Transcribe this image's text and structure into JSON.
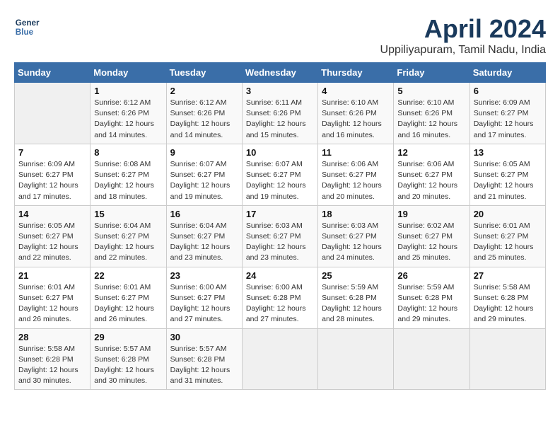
{
  "header": {
    "logo_line1": "General",
    "logo_line2": "Blue",
    "title": "April 2024",
    "subtitle": "Uppiliyapuram, Tamil Nadu, India"
  },
  "calendar": {
    "days_of_week": [
      "Sunday",
      "Monday",
      "Tuesday",
      "Wednesday",
      "Thursday",
      "Friday",
      "Saturday"
    ],
    "weeks": [
      [
        {
          "day": "",
          "info": ""
        },
        {
          "day": "1",
          "info": "Sunrise: 6:12 AM\nSunset: 6:26 PM\nDaylight: 12 hours\nand 14 minutes."
        },
        {
          "day": "2",
          "info": "Sunrise: 6:12 AM\nSunset: 6:26 PM\nDaylight: 12 hours\nand 14 minutes."
        },
        {
          "day": "3",
          "info": "Sunrise: 6:11 AM\nSunset: 6:26 PM\nDaylight: 12 hours\nand 15 minutes."
        },
        {
          "day": "4",
          "info": "Sunrise: 6:10 AM\nSunset: 6:26 PM\nDaylight: 12 hours\nand 16 minutes."
        },
        {
          "day": "5",
          "info": "Sunrise: 6:10 AM\nSunset: 6:26 PM\nDaylight: 12 hours\nand 16 minutes."
        },
        {
          "day": "6",
          "info": "Sunrise: 6:09 AM\nSunset: 6:27 PM\nDaylight: 12 hours\nand 17 minutes."
        }
      ],
      [
        {
          "day": "7",
          "info": "Sunrise: 6:09 AM\nSunset: 6:27 PM\nDaylight: 12 hours\nand 17 minutes."
        },
        {
          "day": "8",
          "info": "Sunrise: 6:08 AM\nSunset: 6:27 PM\nDaylight: 12 hours\nand 18 minutes."
        },
        {
          "day": "9",
          "info": "Sunrise: 6:07 AM\nSunset: 6:27 PM\nDaylight: 12 hours\nand 19 minutes."
        },
        {
          "day": "10",
          "info": "Sunrise: 6:07 AM\nSunset: 6:27 PM\nDaylight: 12 hours\nand 19 minutes."
        },
        {
          "day": "11",
          "info": "Sunrise: 6:06 AM\nSunset: 6:27 PM\nDaylight: 12 hours\nand 20 minutes."
        },
        {
          "day": "12",
          "info": "Sunrise: 6:06 AM\nSunset: 6:27 PM\nDaylight: 12 hours\nand 20 minutes."
        },
        {
          "day": "13",
          "info": "Sunrise: 6:05 AM\nSunset: 6:27 PM\nDaylight: 12 hours\nand 21 minutes."
        }
      ],
      [
        {
          "day": "14",
          "info": "Sunrise: 6:05 AM\nSunset: 6:27 PM\nDaylight: 12 hours\nand 22 minutes."
        },
        {
          "day": "15",
          "info": "Sunrise: 6:04 AM\nSunset: 6:27 PM\nDaylight: 12 hours\nand 22 minutes."
        },
        {
          "day": "16",
          "info": "Sunrise: 6:04 AM\nSunset: 6:27 PM\nDaylight: 12 hours\nand 23 minutes."
        },
        {
          "day": "17",
          "info": "Sunrise: 6:03 AM\nSunset: 6:27 PM\nDaylight: 12 hours\nand 23 minutes."
        },
        {
          "day": "18",
          "info": "Sunrise: 6:03 AM\nSunset: 6:27 PM\nDaylight: 12 hours\nand 24 minutes."
        },
        {
          "day": "19",
          "info": "Sunrise: 6:02 AM\nSunset: 6:27 PM\nDaylight: 12 hours\nand 25 minutes."
        },
        {
          "day": "20",
          "info": "Sunrise: 6:01 AM\nSunset: 6:27 PM\nDaylight: 12 hours\nand 25 minutes."
        }
      ],
      [
        {
          "day": "21",
          "info": "Sunrise: 6:01 AM\nSunset: 6:27 PM\nDaylight: 12 hours\nand 26 minutes."
        },
        {
          "day": "22",
          "info": "Sunrise: 6:01 AM\nSunset: 6:27 PM\nDaylight: 12 hours\nand 26 minutes."
        },
        {
          "day": "23",
          "info": "Sunrise: 6:00 AM\nSunset: 6:27 PM\nDaylight: 12 hours\nand 27 minutes."
        },
        {
          "day": "24",
          "info": "Sunrise: 6:00 AM\nSunset: 6:28 PM\nDaylight: 12 hours\nand 27 minutes."
        },
        {
          "day": "25",
          "info": "Sunrise: 5:59 AM\nSunset: 6:28 PM\nDaylight: 12 hours\nand 28 minutes."
        },
        {
          "day": "26",
          "info": "Sunrise: 5:59 AM\nSunset: 6:28 PM\nDaylight: 12 hours\nand 29 minutes."
        },
        {
          "day": "27",
          "info": "Sunrise: 5:58 AM\nSunset: 6:28 PM\nDaylight: 12 hours\nand 29 minutes."
        }
      ],
      [
        {
          "day": "28",
          "info": "Sunrise: 5:58 AM\nSunset: 6:28 PM\nDaylight: 12 hours\nand 30 minutes."
        },
        {
          "day": "29",
          "info": "Sunrise: 5:57 AM\nSunset: 6:28 PM\nDaylight: 12 hours\nand 30 minutes."
        },
        {
          "day": "30",
          "info": "Sunrise: 5:57 AM\nSunset: 6:28 PM\nDaylight: 12 hours\nand 31 minutes."
        },
        {
          "day": "",
          "info": ""
        },
        {
          "day": "",
          "info": ""
        },
        {
          "day": "",
          "info": ""
        },
        {
          "day": "",
          "info": ""
        }
      ]
    ]
  }
}
